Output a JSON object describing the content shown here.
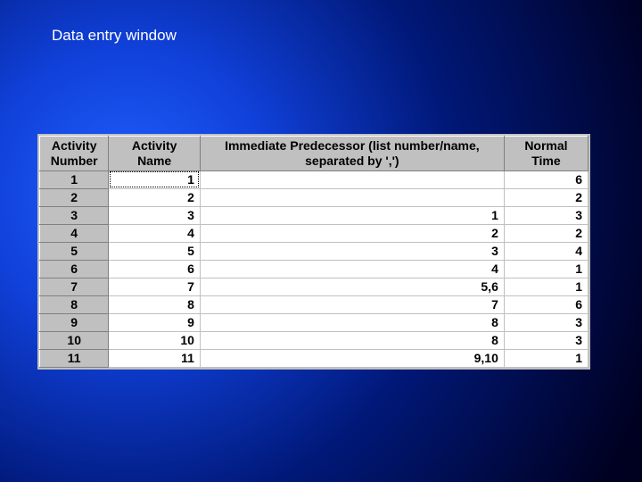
{
  "title": "Data entry window",
  "table": {
    "headers": {
      "activity_number": "Activity\nNumber",
      "activity_name": "Activity\nName",
      "immediate_predecessor": "Immediate Predecessor (list number/name, separated by ',')",
      "normal_time": "Normal\nTime"
    },
    "rows": [
      {
        "num": "1",
        "name": "1",
        "pred": "",
        "time": "6"
      },
      {
        "num": "2",
        "name": "2",
        "pred": "",
        "time": "2"
      },
      {
        "num": "3",
        "name": "3",
        "pred": "1",
        "time": "3"
      },
      {
        "num": "4",
        "name": "4",
        "pred": "2",
        "time": "2"
      },
      {
        "num": "5",
        "name": "5",
        "pred": "3",
        "time": "4"
      },
      {
        "num": "6",
        "name": "6",
        "pred": "4",
        "time": "1"
      },
      {
        "num": "7",
        "name": "7",
        "pred": "5,6",
        "time": "1"
      },
      {
        "num": "8",
        "name": "8",
        "pred": "7",
        "time": "6"
      },
      {
        "num": "9",
        "name": "9",
        "pred": "8",
        "time": "3"
      },
      {
        "num": "10",
        "name": "10",
        "pred": "8",
        "time": "3"
      },
      {
        "num": "11",
        "name": "11",
        "pred": "9,10",
        "time": "1"
      }
    ]
  }
}
